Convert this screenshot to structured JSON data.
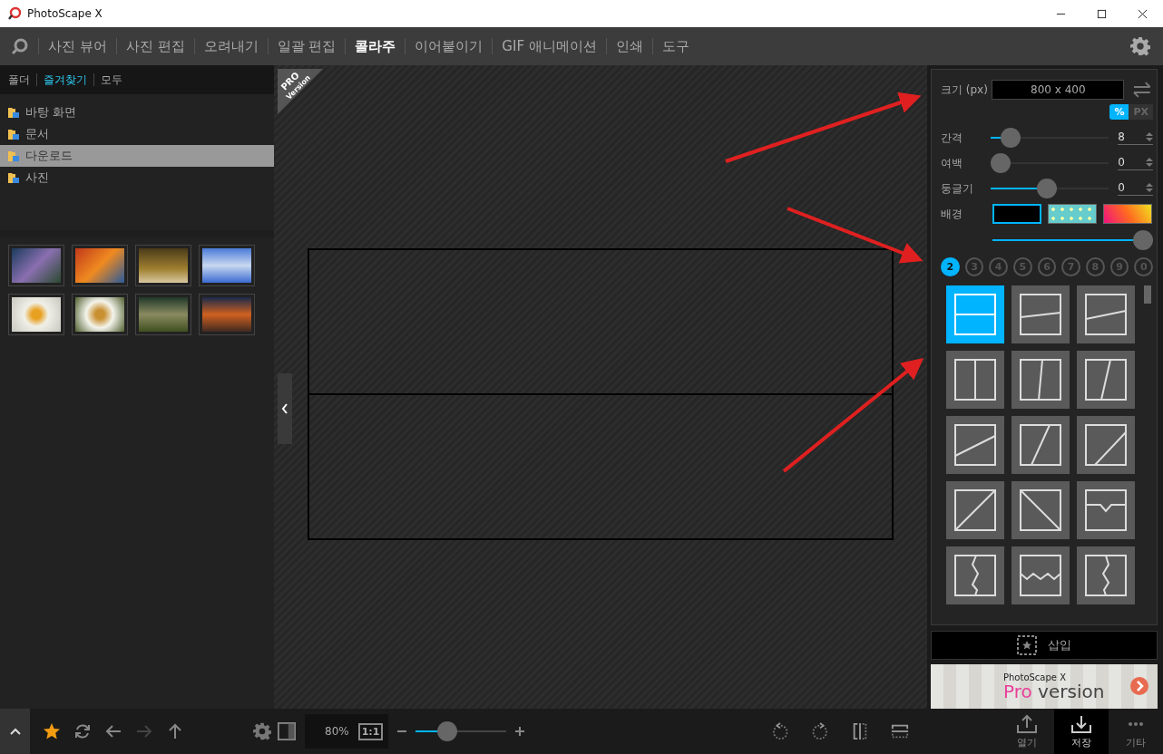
{
  "window": {
    "title": "PhotoScape X"
  },
  "menu": [
    {
      "label": "사진 뷰어",
      "selected": false
    },
    {
      "label": "사진 편집",
      "selected": false
    },
    {
      "label": "오려내기",
      "selected": false
    },
    {
      "label": "일괄 편집",
      "selected": false
    },
    {
      "label": "콜라주",
      "selected": true
    },
    {
      "label": "이어붙이기",
      "selected": false
    },
    {
      "label": "GIF 애니메이션",
      "selected": false
    },
    {
      "label": "인쇄",
      "selected": false
    },
    {
      "label": "도구",
      "selected": false
    }
  ],
  "sidebar": {
    "tabs": [
      {
        "label": "폴더",
        "selected": false
      },
      {
        "label": "즐겨찾기",
        "selected": true
      },
      {
        "label": "모두",
        "selected": false
      }
    ],
    "folders": [
      {
        "label": "바탕 화면",
        "selected": false
      },
      {
        "label": "문서",
        "selected": false
      },
      {
        "label": "다운로드",
        "selected": true
      },
      {
        "label": "사진",
        "selected": false
      }
    ]
  },
  "canvas": {
    "badge_title": "PRO",
    "badge_subtitle": "Version"
  },
  "settings": {
    "size_label": "크기 (px)",
    "size_value": "800 x 400",
    "units": [
      {
        "label": "%",
        "selected": true
      },
      {
        "label": "PX",
        "selected": false
      }
    ],
    "sliders": [
      {
        "label": "간격",
        "level": 0.1,
        "value": "8"
      },
      {
        "label": "여백",
        "level": 0,
        "value": "0"
      },
      {
        "label": "둥글기",
        "level": 0.47,
        "value": "0"
      }
    ],
    "background_label": "배경",
    "backgrounds": [
      {
        "kind": "solid",
        "selected": true
      },
      {
        "kind": "dots",
        "selected": false
      },
      {
        "kind": "gradient",
        "selected": false
      }
    ],
    "opacity": {
      "level": 1
    },
    "counts": [
      {
        "label": "2",
        "selected": true
      },
      {
        "label": "3",
        "selected": false
      },
      {
        "label": "4",
        "selected": false
      },
      {
        "label": "5",
        "selected": false
      },
      {
        "label": "6",
        "selected": false
      },
      {
        "label": "7",
        "selected": false
      },
      {
        "label": "8",
        "selected": false
      },
      {
        "label": "9",
        "selected": false
      },
      {
        "label": "0",
        "selected": false
      }
    ],
    "layouts": [
      {
        "kind": "h",
        "selected": true
      },
      {
        "kind": "h-tilt",
        "selected": false
      },
      {
        "kind": "h-tilt-more",
        "selected": false
      },
      {
        "kind": "v",
        "selected": false
      },
      {
        "kind": "v-tilt",
        "selected": false
      },
      {
        "kind": "v-tilt-more",
        "selected": false
      },
      {
        "kind": "diag-shallow",
        "selected": false
      },
      {
        "kind": "diag-steep",
        "selected": false
      },
      {
        "kind": "diag-mid",
        "selected": false
      },
      {
        "kind": "diag",
        "selected": false
      },
      {
        "kind": "anti-diag",
        "selected": false
      },
      {
        "kind": "notch",
        "selected": false
      },
      {
        "kind": "zigzag-v",
        "selected": false
      },
      {
        "kind": "zigzag-h",
        "selected": false
      },
      {
        "kind": "zigzag-v-alt",
        "selected": false
      }
    ]
  },
  "insert_button": "삽입",
  "ad": {
    "brand": "PhotoScape X",
    "highlight": "Pro",
    "text": "version"
  },
  "toolbar": {
    "zoom": "80%",
    "actual_size": "1:1",
    "zoom_slider": {
      "level": 0.3
    }
  },
  "actions": [
    {
      "label": "열기",
      "kind": "open",
      "selected": false
    },
    {
      "label": "저장",
      "kind": "save",
      "selected": true
    },
    {
      "label": "기타",
      "kind": "more",
      "selected": false
    }
  ]
}
